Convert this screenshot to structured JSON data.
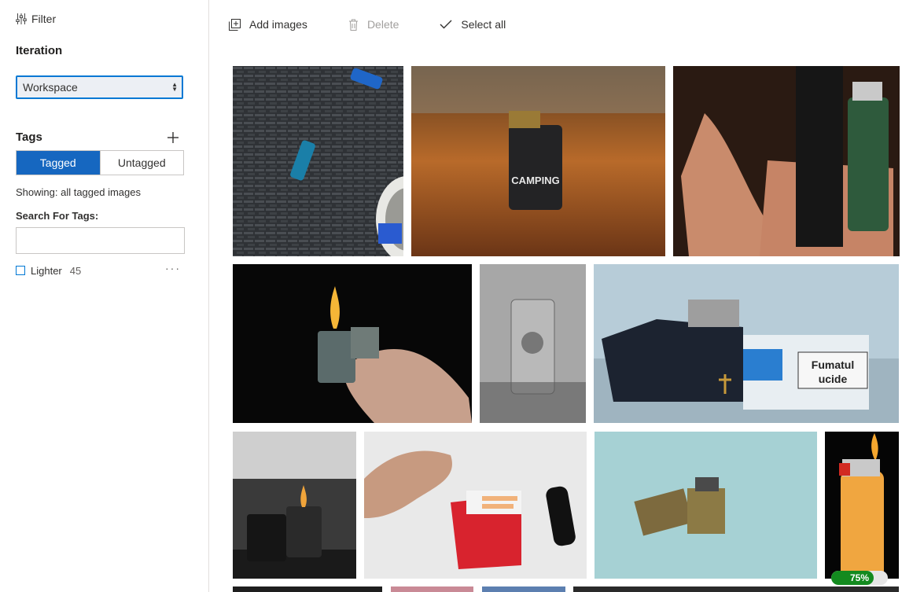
{
  "sidebar": {
    "filter_label": "Filter",
    "iteration_title": "Iteration",
    "iteration_select": "Workspace",
    "tags_title": "Tags",
    "toggle": {
      "tagged": "Tagged",
      "untagged": "Untagged",
      "selected": "Tagged"
    },
    "showing_text": "Showing: all tagged images",
    "search_label": "Search For Tags:",
    "search_value": "",
    "tags": [
      {
        "name": "Lighter",
        "count": "45",
        "checked": false
      }
    ]
  },
  "toolbar": {
    "add_images": "Add images",
    "delete": "Delete",
    "select_all": "Select all"
  },
  "upload_progress": {
    "label": "75%",
    "fraction": 0.75
  },
  "images": [
    {
      "subject": "blue lighter on wicker mat"
    },
    {
      "subject": "camping lighter on wooden table"
    },
    {
      "subject": "hand holding vape and green lighter"
    },
    {
      "subject": "hand flicking zippo lighter on black"
    },
    {
      "subject": "engraved zippo on silver surface"
    },
    {
      "subject": "zippo next to cigarette pack"
    },
    {
      "subject": "lit zippo black and white"
    },
    {
      "subject": "hand with cigarette pack and lighter"
    },
    {
      "subject": "gold zippo on teal background"
    },
    {
      "subject": "orange lighter with flame"
    }
  ],
  "image_texts": {
    "camping": "CAMPING",
    "pack_line1": "Fumatul",
    "pack_line2": "ucide"
  },
  "colors": {
    "accent": "#0078d4",
    "toggle_active": "#1667c0",
    "progress": "#138a1f"
  }
}
